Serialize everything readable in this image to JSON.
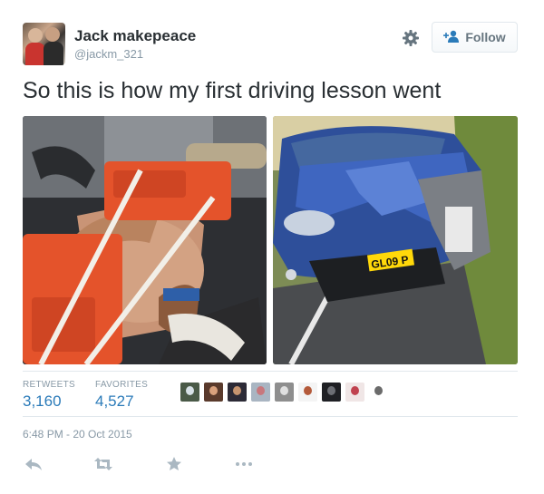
{
  "user": {
    "name": "Jack makepeace",
    "handle": "@jackm_321"
  },
  "follow_button": {
    "label": "Follow",
    "icon": "add-user-icon"
  },
  "settings_icon": "gear-icon",
  "tweet": {
    "text": "So this is how my first driving lesson went",
    "license_plate": "GL09 P"
  },
  "stats": {
    "retweets_label": "RETWEETS",
    "retweets_value": "3,160",
    "favorites_label": "FAVORITES",
    "favorites_value": "4,527",
    "favoriter_avatar_count": 9
  },
  "timestamp": "6:48 PM - 20 Oct 2015",
  "actions": [
    "reply-icon",
    "retweet-icon",
    "favorite-icon",
    "more-icon"
  ],
  "colors": {
    "link_blue": "#2b7bb9",
    "muted": "#8899a6",
    "text": "#292f33",
    "border": "#e1e8ed"
  }
}
